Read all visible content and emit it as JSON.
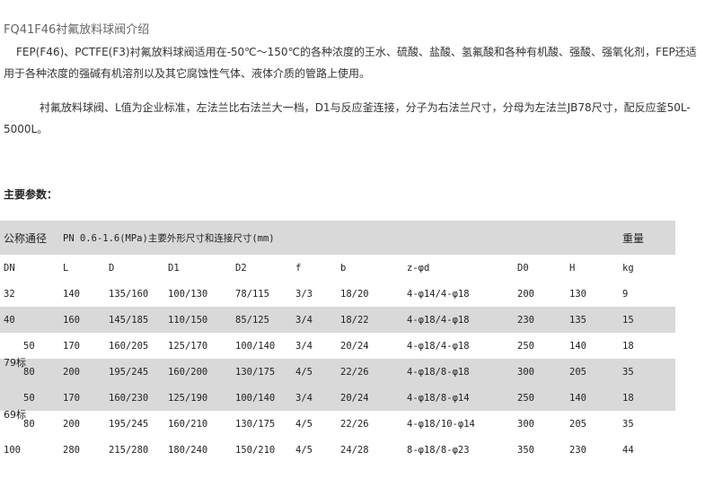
{
  "title": "FQ41F46衬氟放料球阀介绍",
  "intro": "FEP(F46)、PCTFE(F3)衬氟放料球阀适用在-50℃～150℃的各种浓度的王水、硫酸、盐酸、氢氟酸和各种有机酸、强酸、强氧化剂，FEP还适用于各种浓度的强碱有机溶剂以及其它腐蚀性气体、液体介质的管路上使用。",
  "note": "衬氟放料球阀、L值为企业标准，左法兰比右法兰大一档，D1与反应釜连接，分子为右法兰尺寸，分母为左法兰JB78尺寸，配反应釜50L-5000L。",
  "subtitle": "主要参数：",
  "table": {
    "header": {
      "nominal": "公称通径",
      "spec": "PN 0.6-1.6(MPa)主要外形尺寸和连接尺寸(mm)",
      "weight": "重量"
    },
    "units": [
      "DN",
      "L",
      "D",
      "D1",
      "D2",
      "f",
      "b",
      "z-φd",
      "D0",
      "H",
      "kg"
    ],
    "groups": [
      "79标",
      "69标"
    ],
    "rows": [
      [
        "32",
        "140",
        "135/160",
        "100/130",
        "78/115",
        "3/3",
        "18/20",
        "4-φ14/4-φ18",
        "200",
        "130",
        "9"
      ],
      [
        "40",
        "160",
        "145/185",
        "110/150",
        "85/125",
        "3/4",
        "18/22",
        "4-φ18/4-φ18",
        "230",
        "135",
        "15"
      ],
      [
        "50",
        "170",
        "160/205",
        "125/170",
        "100/140",
        "3/4",
        "20/24",
        "4-φ18/4-φ18",
        "250",
        "140",
        "18"
      ],
      [
        "80",
        "200",
        "195/245",
        "160/200",
        "130/175",
        "4/5",
        "22/26",
        "4-φ18/8-φ18",
        "300",
        "205",
        "35"
      ],
      [
        "50",
        "170",
        "160/230",
        "125/190",
        "100/140",
        "3/4",
        "20/24",
        "4-φ18/8-φ14",
        "250",
        "140",
        "18"
      ],
      [
        "80",
        "200",
        "195/245",
        "160/210",
        "130/175",
        "4/5",
        "22/26",
        "4-φ18/10-φ14",
        "300",
        "205",
        "35"
      ],
      [
        "100",
        "280",
        "215/280",
        "180/240",
        "150/210",
        "4/5",
        "24/28",
        "8-φ18/8-φ23",
        "350",
        "230",
        "44"
      ]
    ]
  }
}
